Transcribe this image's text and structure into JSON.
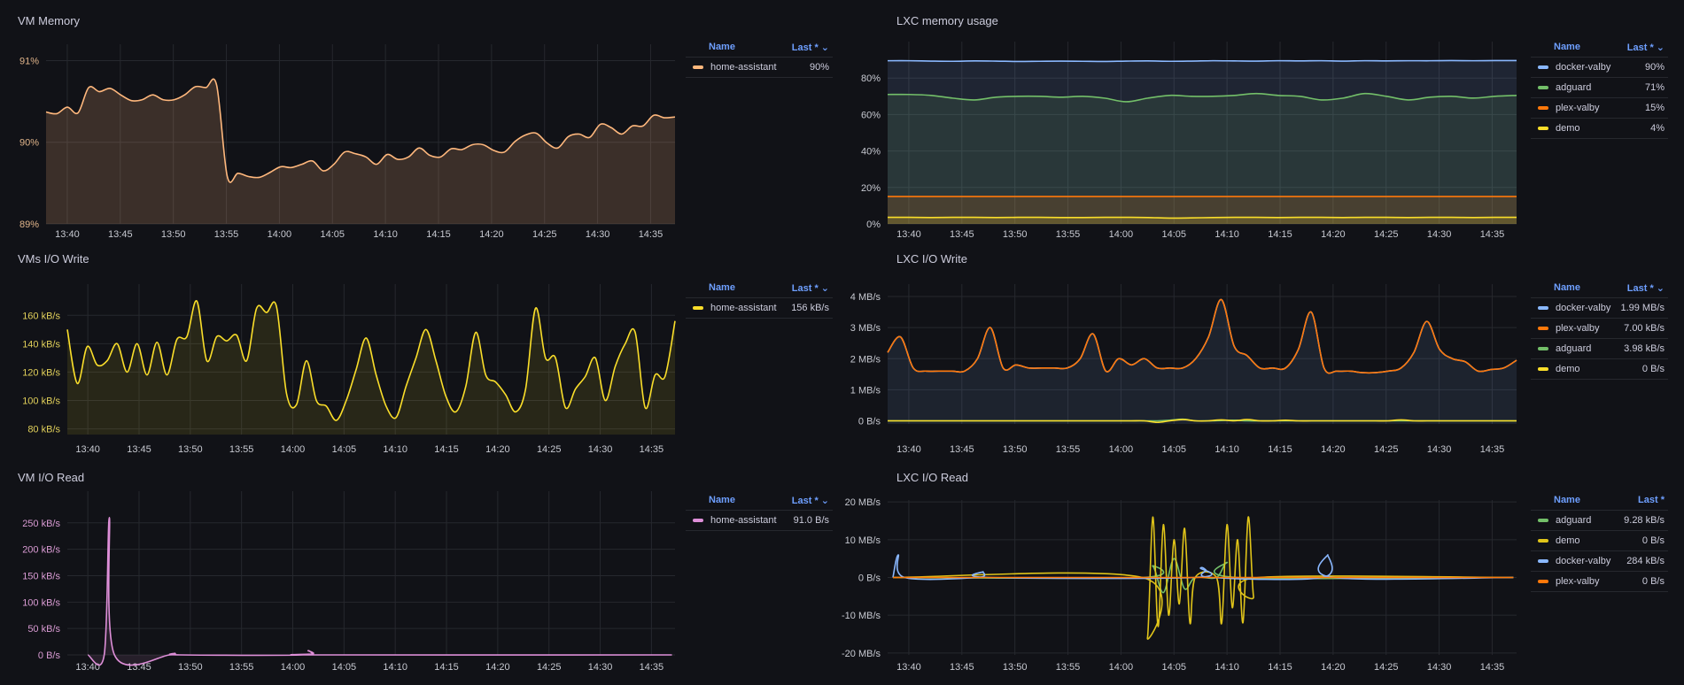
{
  "legend_header": {
    "name": "Name",
    "last": "Last *"
  },
  "chart_data": [
    {
      "type": "line",
      "title": "VM Memory",
      "x_start": "13:38",
      "xticks": [
        "13:40",
        "13:45",
        "13:50",
        "13:55",
        "14:00",
        "14:05",
        "14:10",
        "14:15",
        "14:20",
        "14:25",
        "14:30",
        "14:35"
      ],
      "ylim": [
        89,
        91.2
      ],
      "yticks": [
        89,
        90,
        91
      ],
      "ytick_labels": [
        "89%",
        "90%",
        "91%"
      ],
      "series": [
        {
          "name": "home-assistant",
          "last": "90%",
          "color": "#ffb87d",
          "fill": 0.18,
          "values": [
            90.37,
            90.35,
            90.43,
            90.36,
            90.67,
            90.62,
            90.66,
            90.58,
            90.51,
            90.52,
            90.58,
            90.52,
            90.52,
            90.58,
            90.68,
            90.67,
            90.7,
            89.58,
            89.62,
            89.58,
            89.57,
            89.63,
            89.7,
            89.69,
            89.73,
            89.77,
            89.65,
            89.73,
            89.88,
            89.86,
            89.82,
            89.73,
            89.85,
            89.79,
            89.82,
            89.93,
            89.84,
            89.82,
            89.92,
            89.91,
            89.97,
            89.97,
            89.9,
            89.88,
            90.01,
            90.09,
            90.11,
            89.99,
            89.93,
            90.07,
            90.1,
            90.06,
            90.22,
            90.18,
            90.1,
            90.2,
            90.2,
            90.33,
            90.3,
            90.31
          ]
        }
      ]
    },
    {
      "type": "line",
      "title": "LXC memory usage",
      "x_start": "13:38",
      "xticks": [
        "13:40",
        "13:45",
        "13:50",
        "13:55",
        "14:00",
        "14:05",
        "14:10",
        "14:15",
        "14:20",
        "14:25",
        "14:30",
        "14:35"
      ],
      "ylim": [
        0,
        100
      ],
      "yticks": [
        0,
        20,
        40,
        60,
        80
      ],
      "ytick_labels": [
        "0%",
        "20%",
        "40%",
        "60%",
        "80%"
      ],
      "series": [
        {
          "name": "docker-valby",
          "last": "90%",
          "color": "#8ab8ff",
          "fill": 0.12,
          "values": [
            89.5,
            89.5,
            89.3,
            89.2,
            89.4,
            89.3,
            89.1,
            89.2,
            89.3,
            89.2,
            89.1,
            89.3,
            89.4,
            89.2,
            89.3,
            89.5,
            89.4,
            89.3,
            89.5,
            89.4,
            89.5,
            89.3,
            89.5,
            89.4,
            89.5,
            89.5,
            89.6,
            89.5,
            89.6,
            89.6
          ]
        },
        {
          "name": "adguard",
          "last": "71%",
          "color": "#73bf69",
          "fill": 0.12,
          "values": [
            71,
            71,
            70.5,
            69,
            68,
            69.5,
            70,
            70,
            69.5,
            70,
            69,
            67,
            69,
            70.5,
            70,
            70,
            70.5,
            71.5,
            70.5,
            70,
            68,
            69,
            71.5,
            70,
            68,
            69.5,
            70,
            69,
            70,
            70.5
          ]
        },
        {
          "name": "plex-valby",
          "last": "15%",
          "color": "#ff780a",
          "fill": 0.15,
          "values": [
            15,
            15,
            15,
            15,
            15,
            15,
            15,
            15,
            15,
            15,
            15,
            15,
            15,
            15,
            15,
            15,
            15,
            15,
            15,
            15,
            15,
            15,
            15,
            15,
            15,
            15,
            15,
            15,
            15,
            15
          ]
        },
        {
          "name": "demo",
          "last": "4%",
          "color": "#fade2a",
          "fill": 0.15,
          "values": [
            3.6,
            3.6,
            3.5,
            3.6,
            3.6,
            3.5,
            3.6,
            3.6,
            3.5,
            3.5,
            3.6,
            3.6,
            3.5,
            3.2,
            3.3,
            3.5,
            3.6,
            3.6,
            3.5,
            3.6,
            3.6,
            3.5,
            3.6,
            3.6,
            3.5,
            3.6,
            3.6,
            3.5,
            3.6,
            3.6
          ]
        }
      ]
    },
    {
      "type": "line",
      "title": "VMs I/O Write",
      "x_start": "13:38",
      "xticks": [
        "13:40",
        "13:45",
        "13:50",
        "13:55",
        "14:00",
        "14:05",
        "14:10",
        "14:15",
        "14:20",
        "14:25",
        "14:30",
        "14:35"
      ],
      "ylim": [
        76,
        182
      ],
      "yticks": [
        80,
        100,
        120,
        140,
        160
      ],
      "ytick_labels": [
        "80 kB/s",
        "100 kB/s",
        "120 kB/s",
        "140 kB/s",
        "160 kB/s"
      ],
      "series": [
        {
          "name": "home-assistant",
          "last": "156 kB/s",
          "color": "#fade2a",
          "fill": 0.1,
          "values": [
            150,
            112,
            138,
            125,
            128,
            140,
            120,
            140,
            118,
            141,
            118,
            143,
            145,
            170,
            128,
            145,
            142,
            146,
            128,
            165,
            162,
            166,
            105,
            97,
            128,
            100,
            96,
            86,
            100,
            122,
            144,
            118,
            96,
            88,
            110,
            130,
            150,
            128,
            103,
            92,
            110,
            148,
            118,
            113,
            104,
            92,
            108,
            165,
            130,
            130,
            95,
            108,
            117,
            130,
            100,
            124,
            140,
            148,
            95,
            118,
            117,
            156
          ]
        }
      ]
    },
    {
      "type": "line",
      "title": "LXC I/O Write",
      "x_start": "13:38",
      "xticks": [
        "13:40",
        "13:45",
        "13:50",
        "13:55",
        "14:00",
        "14:05",
        "14:10",
        "14:15",
        "14:20",
        "14:25",
        "14:30",
        "14:35"
      ],
      "ylim": [
        -0.1,
        4.4
      ],
      "yticks": [
        0,
        1,
        2,
        3,
        4
      ],
      "ytick_labels": [
        "0 B/s",
        "1 MB/s",
        "2 MB/s",
        "3 MB/s",
        "4 MB/s"
      ],
      "series": [
        {
          "name": "docker-valby",
          "last": "1.99 MB/s",
          "color": "#8ab8ff",
          "fill": 0.1,
          "values": [
            2.2,
            2.7,
            1.7,
            1.6,
            1.6,
            1.6,
            1.6,
            2.0,
            3.0,
            1.7,
            1.8,
            1.7,
            1.7,
            1.7,
            1.7,
            2.0,
            2.8,
            1.6,
            2.0,
            1.8,
            2.0,
            1.7,
            1.7,
            1.7,
            2.0,
            2.7,
            3.9,
            2.4,
            2.1,
            1.7,
            1.7,
            1.7,
            2.3,
            3.5,
            1.7,
            1.6,
            1.6,
            1.55,
            1.55,
            1.6,
            1.7,
            2.2,
            3.2,
            2.3,
            2.0,
            1.9,
            1.6,
            1.65,
            1.7,
            1.95
          ]
        },
        {
          "name": "plex-valby",
          "last": "7.00 kB/s",
          "color": "#ff780a",
          "fill": 0,
          "values": [
            2.2,
            2.7,
            1.7,
            1.6,
            1.6,
            1.6,
            1.6,
            2.0,
            3.0,
            1.7,
            1.8,
            1.7,
            1.7,
            1.7,
            1.7,
            2.0,
            2.8,
            1.6,
            2.0,
            1.8,
            2.0,
            1.7,
            1.7,
            1.7,
            2.0,
            2.7,
            3.9,
            2.4,
            2.1,
            1.7,
            1.7,
            1.7,
            2.3,
            3.5,
            1.7,
            1.6,
            1.6,
            1.55,
            1.55,
            1.6,
            1.7,
            2.2,
            3.2,
            2.3,
            2.0,
            1.9,
            1.6,
            1.65,
            1.7,
            1.95
          ]
        },
        {
          "name": "adguard",
          "last": "3.98 kB/s",
          "color": "#73bf69",
          "fill": 0,
          "values": [
            0,
            0,
            0,
            0,
            0,
            0,
            0,
            0,
            0,
            0,
            0,
            0,
            0,
            0,
            0,
            0,
            0,
            0,
            0,
            0,
            0,
            0,
            0.02,
            0.05,
            0,
            0,
            0.01,
            0.02,
            0,
            0,
            0,
            0,
            0,
            0,
            0,
            0,
            0,
            0,
            0,
            0,
            0,
            0,
            0,
            0,
            0,
            0,
            0,
            0,
            0,
            0
          ]
        },
        {
          "name": "demo",
          "last": "0 B/s",
          "color": "#fade2a",
          "fill": 0,
          "values": [
            0,
            0,
            0,
            0,
            0,
            0,
            0,
            0,
            0,
            0,
            0,
            0,
            0,
            0,
            0,
            0,
            0,
            0,
            0,
            0,
            0,
            -0.05,
            0,
            0.04,
            0,
            0,
            0.03,
            0,
            0.04,
            0,
            0,
            0.02,
            0,
            0,
            0,
            0,
            0,
            0,
            0,
            0,
            0.03,
            0,
            0,
            0,
            0,
            0,
            0,
            0,
            0,
            0
          ]
        }
      ]
    },
    {
      "type": "line",
      "title": "VM I/O Read",
      "x_start": "13:38",
      "xticks": [
        "13:40",
        "13:45",
        "13:50",
        "13:55",
        "14:00",
        "14:05",
        "14:10",
        "14:15",
        "14:20",
        "14:25",
        "14:30",
        "14:35"
      ],
      "ylim": [
        0,
        310
      ],
      "yticks": [
        0,
        50,
        100,
        150,
        200,
        250
      ],
      "ytick_labels": [
        "0 B/s",
        "50 kB/s",
        "100 kB/s",
        "150 kB/s",
        "200 kB/s",
        "250 kB/s"
      ],
      "series": [
        {
          "name": "home-assistant",
          "last": "91.0 B/s",
          "color": "#de8fd8",
          "fill": 0.1,
          "points": [
            [
              2,
              0
            ],
            [
              3.6,
              0
            ],
            [
              4.1,
              260
            ],
            [
              4.6,
              0
            ],
            [
              10,
              0
            ],
            [
              10.5,
              3
            ],
            [
              11,
              0
            ],
            [
              23,
              0
            ],
            [
              23.5,
              8
            ],
            [
              24,
              2
            ],
            [
              24.5,
              0
            ],
            [
              59,
              0
            ]
          ]
        }
      ]
    },
    {
      "type": "line",
      "title": "LXC I/O Read",
      "x_start": "13:38",
      "xticks": [
        "13:40",
        "13:45",
        "13:50",
        "13:55",
        "14:00",
        "14:05",
        "14:10",
        "14:15",
        "14:20",
        "14:25",
        "14:30",
        "14:35"
      ],
      "ylim": [
        -20.5,
        20.5
      ],
      "yticks": [
        -20,
        -10,
        0,
        10,
        20
      ],
      "ytick_labels": [
        "-20 MB/s",
        "-10 MB/s",
        "0 B/s",
        "10 MB/s",
        "20 MB/s"
      ],
      "series": [
        {
          "name": "adguard",
          "last": "9.28 kB/s",
          "color": "#73bf69",
          "fill": 0,
          "points": [
            [
              0.5,
              0
            ],
            [
              24,
              0
            ],
            [
              25,
              3
            ],
            [
              26,
              -4
            ],
            [
              27,
              5
            ],
            [
              28,
              -3
            ],
            [
              29,
              0
            ],
            [
              31,
              0
            ],
            [
              32,
              4
            ],
            [
              33,
              0
            ],
            [
              59,
              0
            ]
          ]
        },
        {
          "name": "demo",
          "last": "0 B/s",
          "color": "#e0c419",
          "fill": 0,
          "points": [
            [
              0.5,
              0
            ],
            [
              24,
              0
            ],
            [
              24.5,
              -16
            ],
            [
              25,
              16
            ],
            [
              25.5,
              -13
            ],
            [
              26,
              14
            ],
            [
              26.5,
              -10
            ],
            [
              27,
              10
            ],
            [
              27.5,
              -7
            ],
            [
              28,
              13
            ],
            [
              28.5,
              -12
            ],
            [
              29,
              0
            ],
            [
              31,
              0
            ],
            [
              31.5,
              -12
            ],
            [
              32,
              14
            ],
            [
              32.5,
              -8
            ],
            [
              33,
              10
            ],
            [
              33.5,
              -12
            ],
            [
              34,
              16
            ],
            [
              34.5,
              -5
            ],
            [
              35,
              0
            ],
            [
              59,
              0
            ]
          ]
        },
        {
          "name": "docker-valby",
          "last": "284 kB/s",
          "color": "#8ab8ff",
          "fill": 0,
          "points": [
            [
              0.5,
              0
            ],
            [
              1,
              6
            ],
            [
              1.6,
              0
            ],
            [
              8.5,
              0
            ],
            [
              9,
              1.5
            ],
            [
              9.6,
              0
            ],
            [
              29,
              0
            ],
            [
              29.5,
              2.5
            ],
            [
              30,
              2
            ],
            [
              30.5,
              0
            ],
            [
              41,
              0
            ],
            [
              41.5,
              6
            ],
            [
              42,
              0
            ],
            [
              59,
              0
            ]
          ]
        },
        {
          "name": "plex-valby",
          "last": "0 B/s",
          "color": "#ff780a",
          "fill": 0,
          "points": [
            [
              0.5,
              0
            ],
            [
              59,
              0
            ]
          ]
        }
      ]
    }
  ]
}
